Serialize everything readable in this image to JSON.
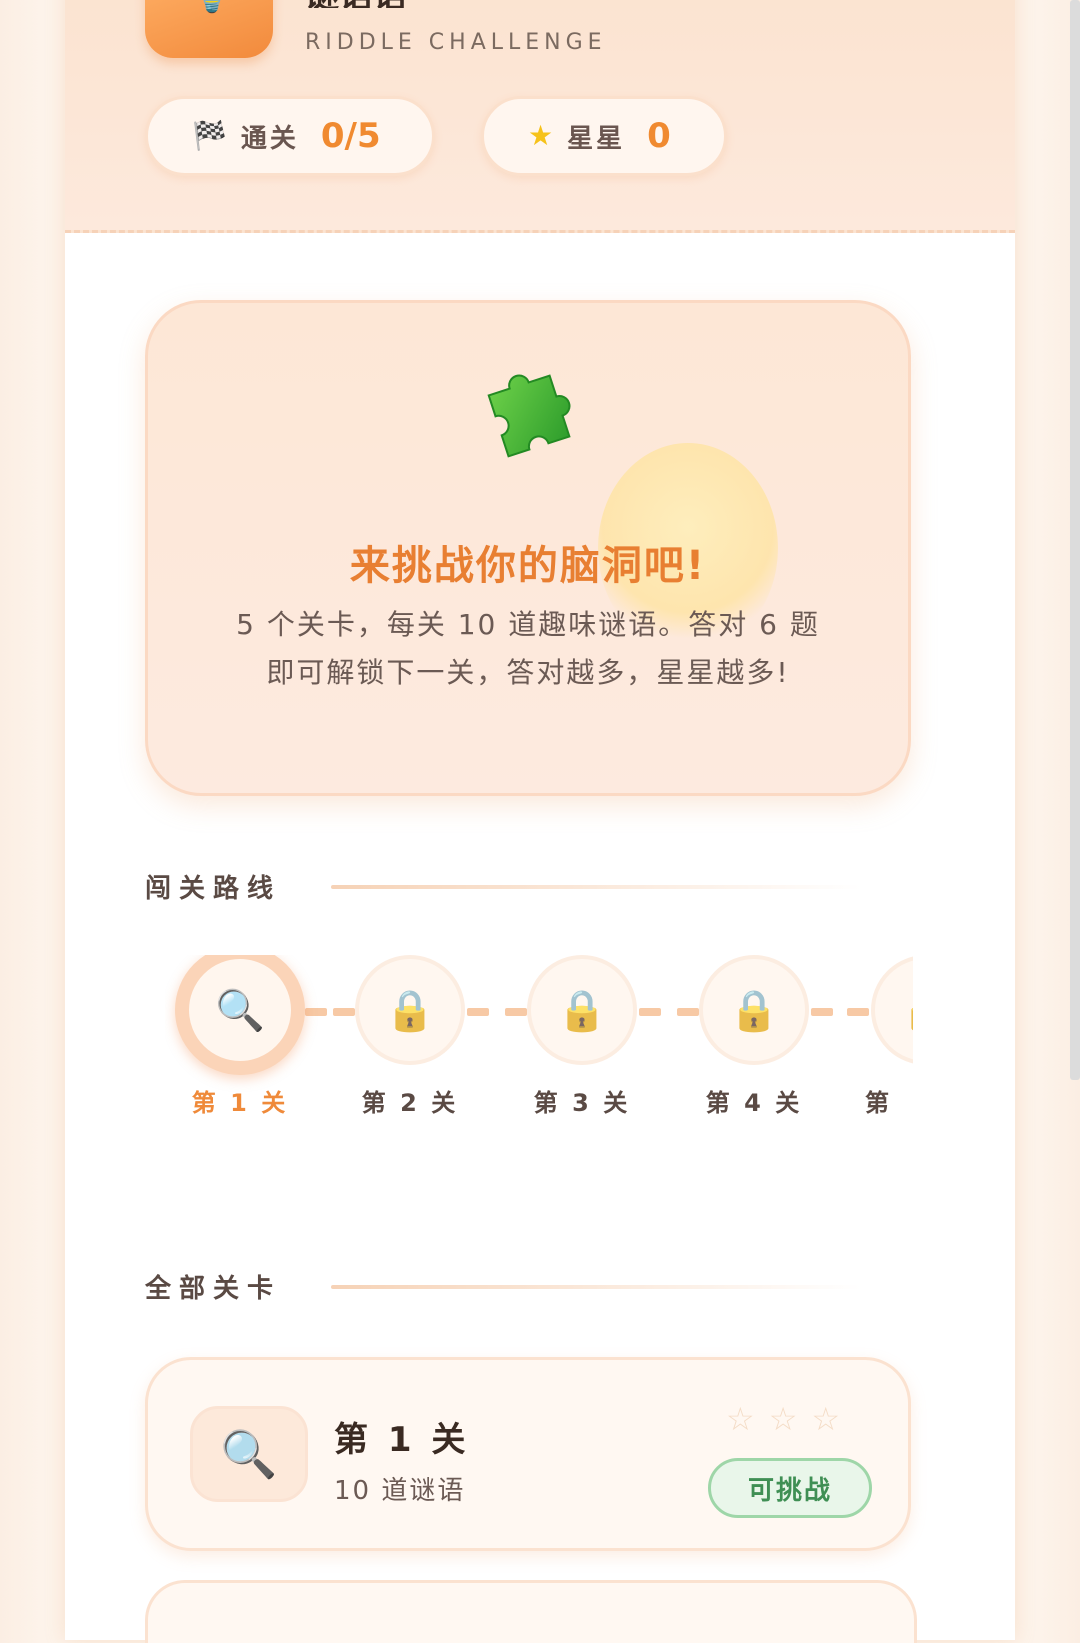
{
  "app": {
    "title": "谜语语",
    "subtitle": "RIDDLE CHALLENGE",
    "icon": "lightbulb-icon"
  },
  "stats": {
    "cleared": {
      "icon": "checkered-flag-icon",
      "label": "通关",
      "value": "0/5"
    },
    "stars": {
      "icon": "star-icon",
      "label": "星星",
      "value": "0"
    }
  },
  "hero": {
    "icon": "puzzle-piece-icon",
    "headline": "来挑战你的脑洞吧!",
    "description": "5 个关卡，每关 10 道趣味谜语。答对 6 题即可解锁下一关，答对越多，星星越多!"
  },
  "route": {
    "title": "闯关路线",
    "nodes": [
      {
        "label": "第 1 关",
        "icon": "magnifier-icon",
        "state": "active"
      },
      {
        "label": "第 2 关",
        "icon": "lock-icon",
        "state": "locked"
      },
      {
        "label": "第 3 关",
        "icon": "lock-icon",
        "state": "locked"
      },
      {
        "label": "第 4 关",
        "icon": "lock-icon",
        "state": "locked"
      },
      {
        "label": "第",
        "icon": "lock-icon",
        "state": "locked"
      }
    ]
  },
  "levels": {
    "title": "全部关卡",
    "items": [
      {
        "name": "第 1 关",
        "subtitle": "10 道谜语",
        "icon": "magnifier-icon",
        "stars": "☆☆☆",
        "status": "可挑战"
      }
    ]
  },
  "colors": {
    "accent": "#ef8a3a",
    "header_bg": "#fbe3d0",
    "success": "#3f8f54"
  }
}
